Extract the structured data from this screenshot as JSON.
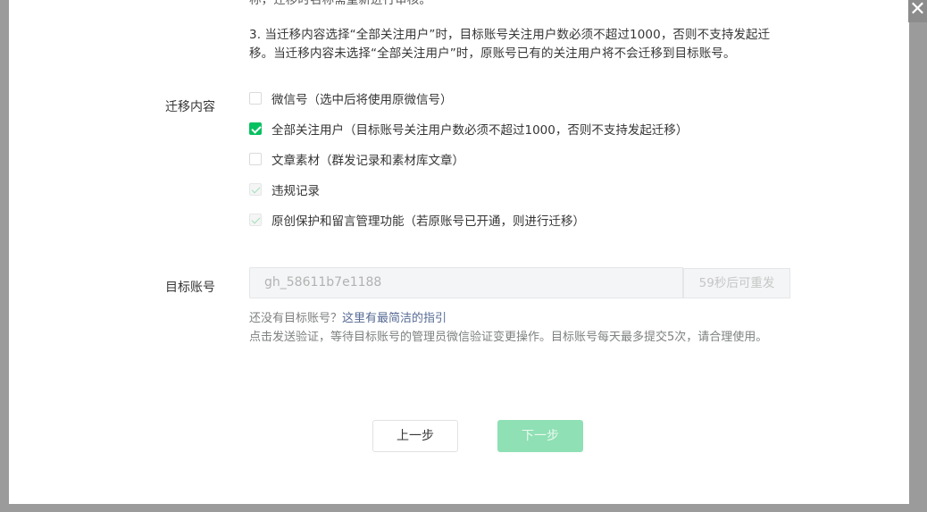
{
  "dialog": {
    "close_label": "✕",
    "note_top": "称，迁移时名称需重新进行审核。",
    "note_3": "3. 当迁移内容选择“全部关注用户”时，目标账号关注用户数必须不超过1000，否则不支持发起迁移。当迁移内容未选择“全部关注用户”时，原账号已有的关注用户将不会迁移到目标账号。"
  },
  "content": {
    "label": "迁移内容",
    "options": [
      {
        "label": "微信号（选中后将使用原微信号）",
        "state": "unchecked"
      },
      {
        "label": "全部关注用户（目标账号关注用户数必须不超过1000，否则不支持发起迁移）",
        "state": "checked"
      },
      {
        "label": "文章素材（群发记录和素材库文章）",
        "state": "unchecked"
      },
      {
        "label": "违规记录",
        "state": "checked-disabled"
      },
      {
        "label": "原创保护和留言管理功能（若原账号已开通，则进行迁移）",
        "state": "checked-disabled"
      }
    ]
  },
  "target": {
    "label": "目标账号",
    "value": "gh_58611b7e1188",
    "resend_label": "59秒后可重发",
    "hint_prefix": "还没有目标账号？",
    "hint_link": "这里有最简洁的指引",
    "hint_desc": "点击发送验证，等待目标账号的管理员微信验证变更操作。目标账号每天最多提交5次，请合理使用。"
  },
  "buttons": {
    "prev": "上一步",
    "next": "下一步"
  },
  "colors": {
    "accent": "#07c160",
    "accent_disabled": "#8fe0b4",
    "link": "#576b95"
  }
}
